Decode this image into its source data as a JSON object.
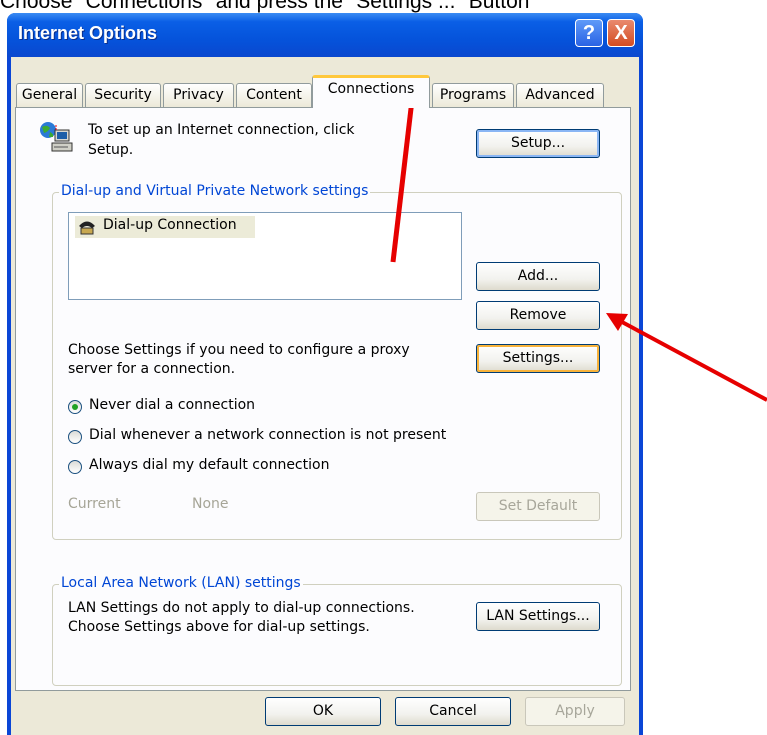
{
  "caption": "Choose \"Connections\" and press the \"Settings ...\" Button",
  "window": {
    "title": "Internet Options",
    "help_label": "?",
    "close_label": "X"
  },
  "tabs": [
    "General",
    "Security",
    "Privacy",
    "Content",
    "Connections",
    "Programs",
    "Advanced"
  ],
  "active_tab": "Connections",
  "setup": {
    "text_line1": "To set up an Internet connection, click",
    "text_line2": "Setup.",
    "button": "Setup..."
  },
  "dialup": {
    "legend": "Dial-up and Virtual Private Network settings",
    "connections": [
      "Dial-up Connection"
    ],
    "add_button": "Add...",
    "remove_button": "Remove",
    "proxy_text_line1": "Choose Settings if you need to configure a proxy",
    "proxy_text_line2": "server for a connection.",
    "settings_button": "Settings...",
    "radios": [
      {
        "label": "Never dial a connection",
        "checked": true
      },
      {
        "label": "Dial whenever a network connection is not present",
        "checked": false
      },
      {
        "label": "Always dial my default connection",
        "checked": false
      }
    ],
    "current_label": "Current",
    "current_value": "None",
    "set_default_button": "Set Default"
  },
  "lan": {
    "legend": "Local Area Network (LAN) settings",
    "text_line1": "LAN Settings do not apply to dial-up connections.",
    "text_line2": "Choose Settings above for dial-up settings.",
    "button": "LAN Settings..."
  },
  "footer": {
    "ok": "OK",
    "cancel": "Cancel",
    "apply": "Apply"
  },
  "colors": {
    "annotation_arrow": "#e60000",
    "title_bar": "#0553db",
    "legend_text": "#0046d5"
  },
  "icons": [
    "globe-computer-icon",
    "dialup-phone-icon",
    "help-icon",
    "close-icon"
  ]
}
